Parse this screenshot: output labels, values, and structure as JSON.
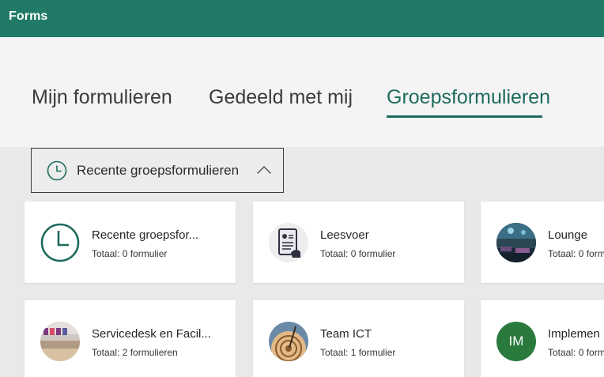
{
  "app": {
    "title": "Forms"
  },
  "tabs": [
    {
      "label": "Mijn formulieren",
      "active": false
    },
    {
      "label": "Gedeeld met mij",
      "active": false
    },
    {
      "label": "Groepsformulieren",
      "active": true
    }
  ],
  "filter": {
    "selected": "Recente groepsformulieren",
    "icon": "clock-icon",
    "state": "expanded"
  },
  "groups": [
    {
      "name": "Recente groepsfor...",
      "count": "Totaal: 0 formulier",
      "icon": "clock-icon"
    },
    {
      "name": "Leesvoer",
      "count": "Totaal: 0 formulier",
      "icon": "document-icon"
    },
    {
      "name": "Lounge",
      "count": "Totaal: 0 form",
      "icon": "lounge-photo"
    },
    {
      "name": "Servicedesk en Facil...",
      "count": "Totaal: 2 formulieren",
      "icon": "servicedesk-photo"
    },
    {
      "name": "Team ICT",
      "count": "Totaal: 1 formulier",
      "icon": "team-ict-photo"
    },
    {
      "name": "Implemen",
      "count": "Totaal: 0 form",
      "icon": "initials-avatar",
      "initials": "IM"
    }
  ],
  "colors": {
    "header": "#217a68",
    "accent": "#1e6b5e",
    "tab_background": "#f4f4f4",
    "content_background": "#e9e9e9",
    "initials_avatar": "#2a7a3e"
  }
}
